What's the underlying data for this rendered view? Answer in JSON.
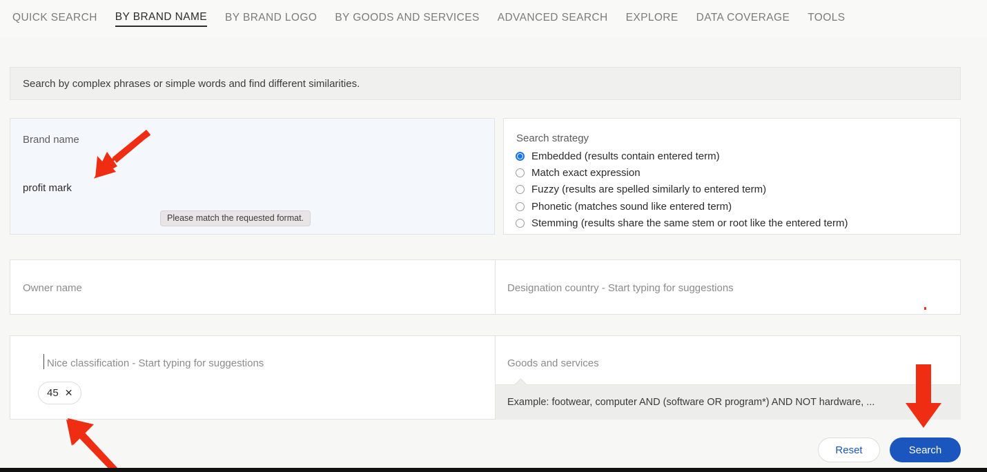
{
  "nav": {
    "items": [
      {
        "label": "QUICK SEARCH",
        "active": false
      },
      {
        "label": "BY BRAND NAME",
        "active": true
      },
      {
        "label": "BY BRAND LOGO",
        "active": false
      },
      {
        "label": "BY GOODS AND SERVICES",
        "active": false
      },
      {
        "label": "ADVANCED SEARCH",
        "active": false
      },
      {
        "label": "EXPLORE",
        "active": false
      },
      {
        "label": "DATA COVERAGE",
        "active": false
      },
      {
        "label": "TOOLS",
        "active": false
      }
    ]
  },
  "banner": {
    "text": "Search by complex phrases or simple words and find different similarities."
  },
  "brand": {
    "label": "Brand name",
    "value": "profit mark",
    "tooltip": "Please match the requested format."
  },
  "strategy": {
    "title": "Search strategy",
    "options": [
      {
        "label": "Embedded (results contain entered term)",
        "selected": true
      },
      {
        "label": "Match exact expression",
        "selected": false
      },
      {
        "label": "Fuzzy (results are spelled similarly to entered term)",
        "selected": false
      },
      {
        "label": "Phonetic (matches sound like entered term)",
        "selected": false
      },
      {
        "label": "Stemming (results share the same stem or root like the entered term)",
        "selected": false
      }
    ]
  },
  "owner": {
    "placeholder": "Owner name",
    "value": ""
  },
  "country": {
    "placeholder": "Designation country - Start typing for suggestions",
    "value": ""
  },
  "nice": {
    "placeholder": "Nice classification - Start typing for suggestions",
    "value": "",
    "chips": [
      {
        "label": "45",
        "remove": "✕"
      }
    ]
  },
  "goods": {
    "placeholder": "Goods and services",
    "value": "",
    "hint": "Example: footwear, computer AND (software OR program*) AND NOT hardware, ..."
  },
  "actions": {
    "reset_label": "Reset",
    "search_label": "Search"
  },
  "colors": {
    "accent_blue": "#1a56bd",
    "radio_blue": "#1a73e8",
    "annotation_red": "#ee2d12",
    "panel_brand_bg": "#f4f8fd",
    "page_bg": "#f7f7f6"
  }
}
